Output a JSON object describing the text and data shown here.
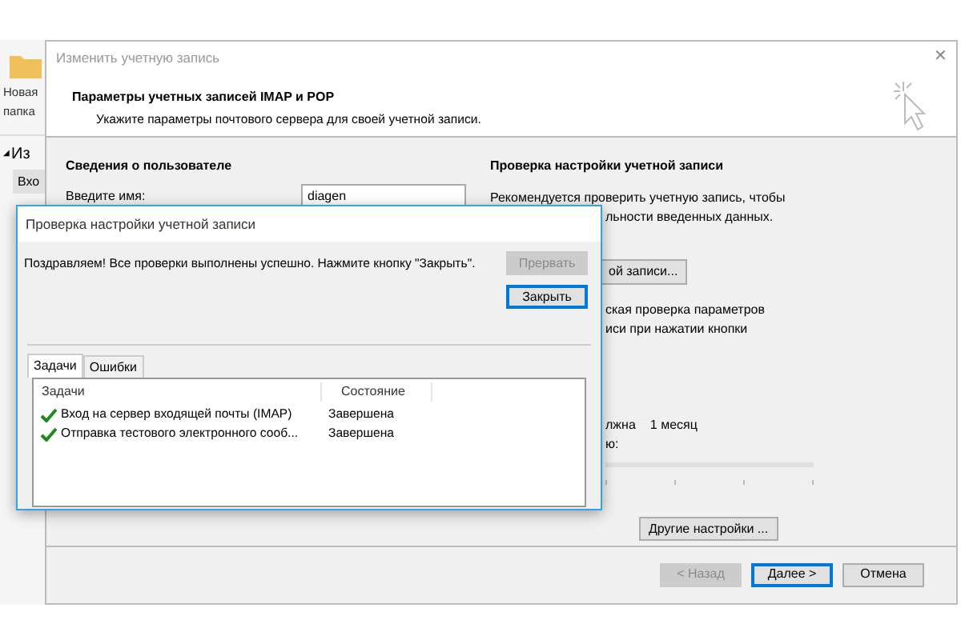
{
  "explorer": {
    "folder_label_lines": [
      "Новая",
      "папка"
    ],
    "collapse_glyph": "◢",
    "section": "Из",
    "row": "Вхо"
  },
  "window": {
    "title": "Изменить учетную запись",
    "close_glyph": "✕"
  },
  "header": {
    "title": "Параметры учетных записей IMAP и POP",
    "subtitle": "Укажите параметры почтового сервера для своей учетной записи."
  },
  "user_info": {
    "title": "Сведения о пользователе",
    "name_label": "Введите имя:",
    "name_value": "diagen"
  },
  "test_section": {
    "title": "Проверка настройки учетной записи",
    "line1": "Рекомендуется проверить учетную запись, чтобы",
    "line2_fragment": "льности введенных данных.",
    "button_fragment": "ой записи...",
    "check_lines": [
      "ская проверка параметров",
      "иси при нажатии кнопки"
    ],
    "offline_fragment": "лжна",
    "offline_value": "1 месяц",
    "offline_line2": "ю:",
    "more_settings": "Другие настройки ..."
  },
  "footer_buttons": [
    {
      "label": "< Назад",
      "disabled": true,
      "focused": false
    },
    {
      "label": "Далее >",
      "disabled": false,
      "focused": true
    },
    {
      "label": "Отмена",
      "disabled": false,
      "focused": false
    }
  ],
  "modal": {
    "title": "Проверка настройки учетной записи",
    "message": "Поздравляем! Все проверки выполнены успешно. Нажмите кнопку \"Закрыть\".",
    "buttons": [
      {
        "label": "Прервать",
        "disabled": true,
        "focused": false
      },
      {
        "label": "Закрыть",
        "disabled": false,
        "focused": true
      }
    ],
    "tabs": [
      {
        "label": "Задачи",
        "selected": true
      },
      {
        "label": "Ошибки",
        "selected": false
      }
    ],
    "columns": [
      "Задачи",
      "Состояние"
    ],
    "rows": [
      {
        "task": "Вход на сервер входящей почты (IMAP)",
        "status": "Завершена",
        "done": true
      },
      {
        "task": "Отправка тестового электронного сооб...",
        "status": "Завершена",
        "done": true
      }
    ]
  }
}
